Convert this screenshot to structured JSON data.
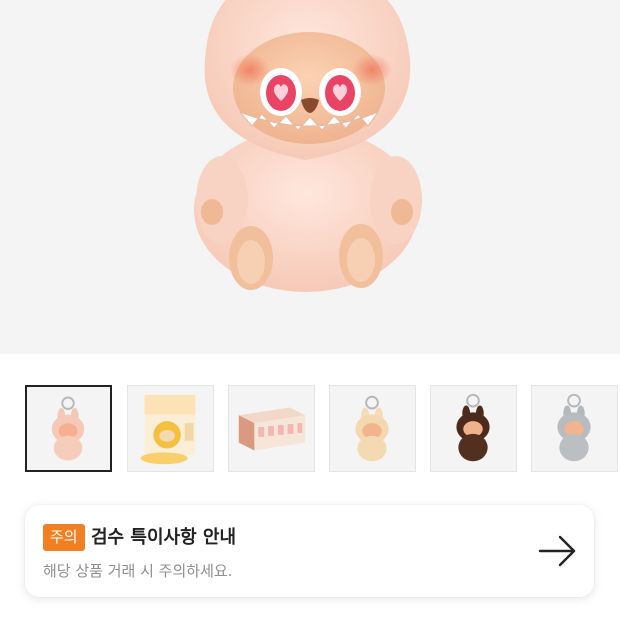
{
  "hero": {
    "icon": "plush-doll-image"
  },
  "thumbnails": [
    {
      "name": "pink-keychain",
      "active": true
    },
    {
      "name": "blind-box-package",
      "active": false
    },
    {
      "name": "display-box-set",
      "active": false
    },
    {
      "name": "beige-keychain",
      "active": false
    },
    {
      "name": "brown-keychain",
      "active": false
    },
    {
      "name": "gray-keychain",
      "active": false
    }
  ],
  "notice": {
    "badge": "주의",
    "title": "검수 특이사항 안내",
    "subtitle": "해당 상품 거래 시 주의하세요.",
    "arrow_icon": "arrow-right-icon"
  },
  "colors": {
    "accent": "#f28022",
    "hero_bg": "#f4f4f4",
    "title_text": "#222222",
    "sub_text": "#8f8f8f"
  }
}
